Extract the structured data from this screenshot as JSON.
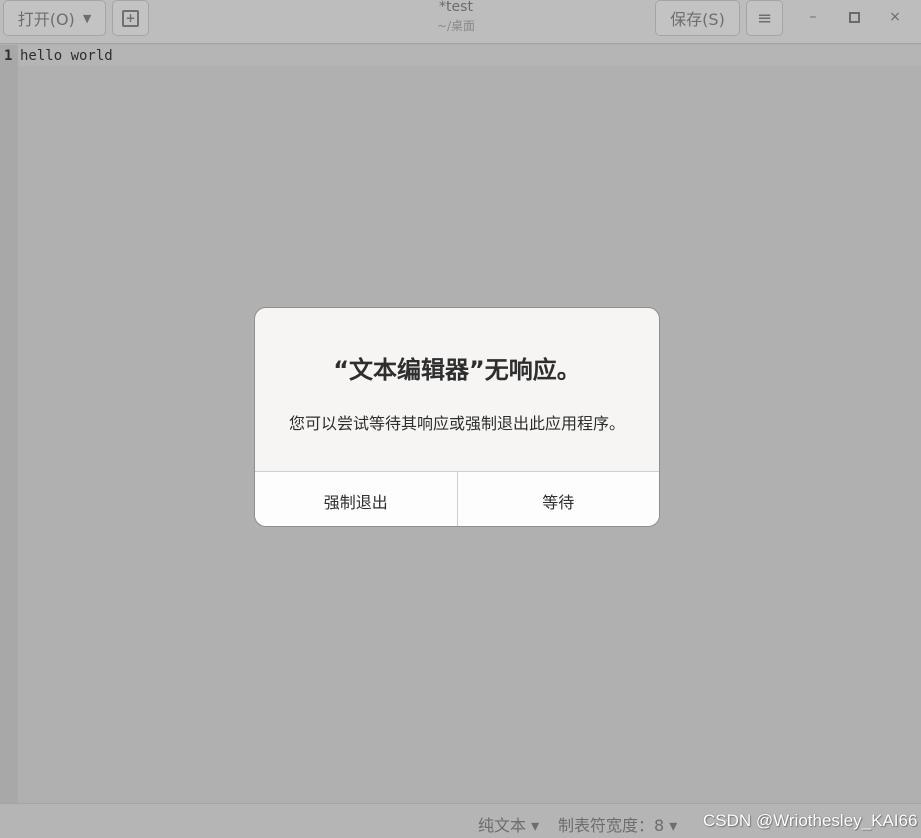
{
  "toolbar": {
    "open_label": "打开(O)",
    "open_arrow": "▼",
    "newtab_glyph": "+",
    "save_label": "保存(S)",
    "menu_glyph": "≡"
  },
  "window": {
    "title": "*test",
    "subtitle": "~/桌面",
    "min_glyph": "–",
    "close_glyph": "×"
  },
  "editor": {
    "line_number": "1",
    "content": "hello world"
  },
  "statusbar": {
    "language": "纯文本 ▾",
    "tab_width": "制表符宽度：8 ▾"
  },
  "watermark": "CSDN @Wriothesley_KAI66",
  "dialog": {
    "title": "“文本编辑器”无响应。",
    "message": "您可以尝试等待其响应或强制退出此应用程序。",
    "force_quit_label": "强制退出",
    "wait_label": "等待"
  }
}
